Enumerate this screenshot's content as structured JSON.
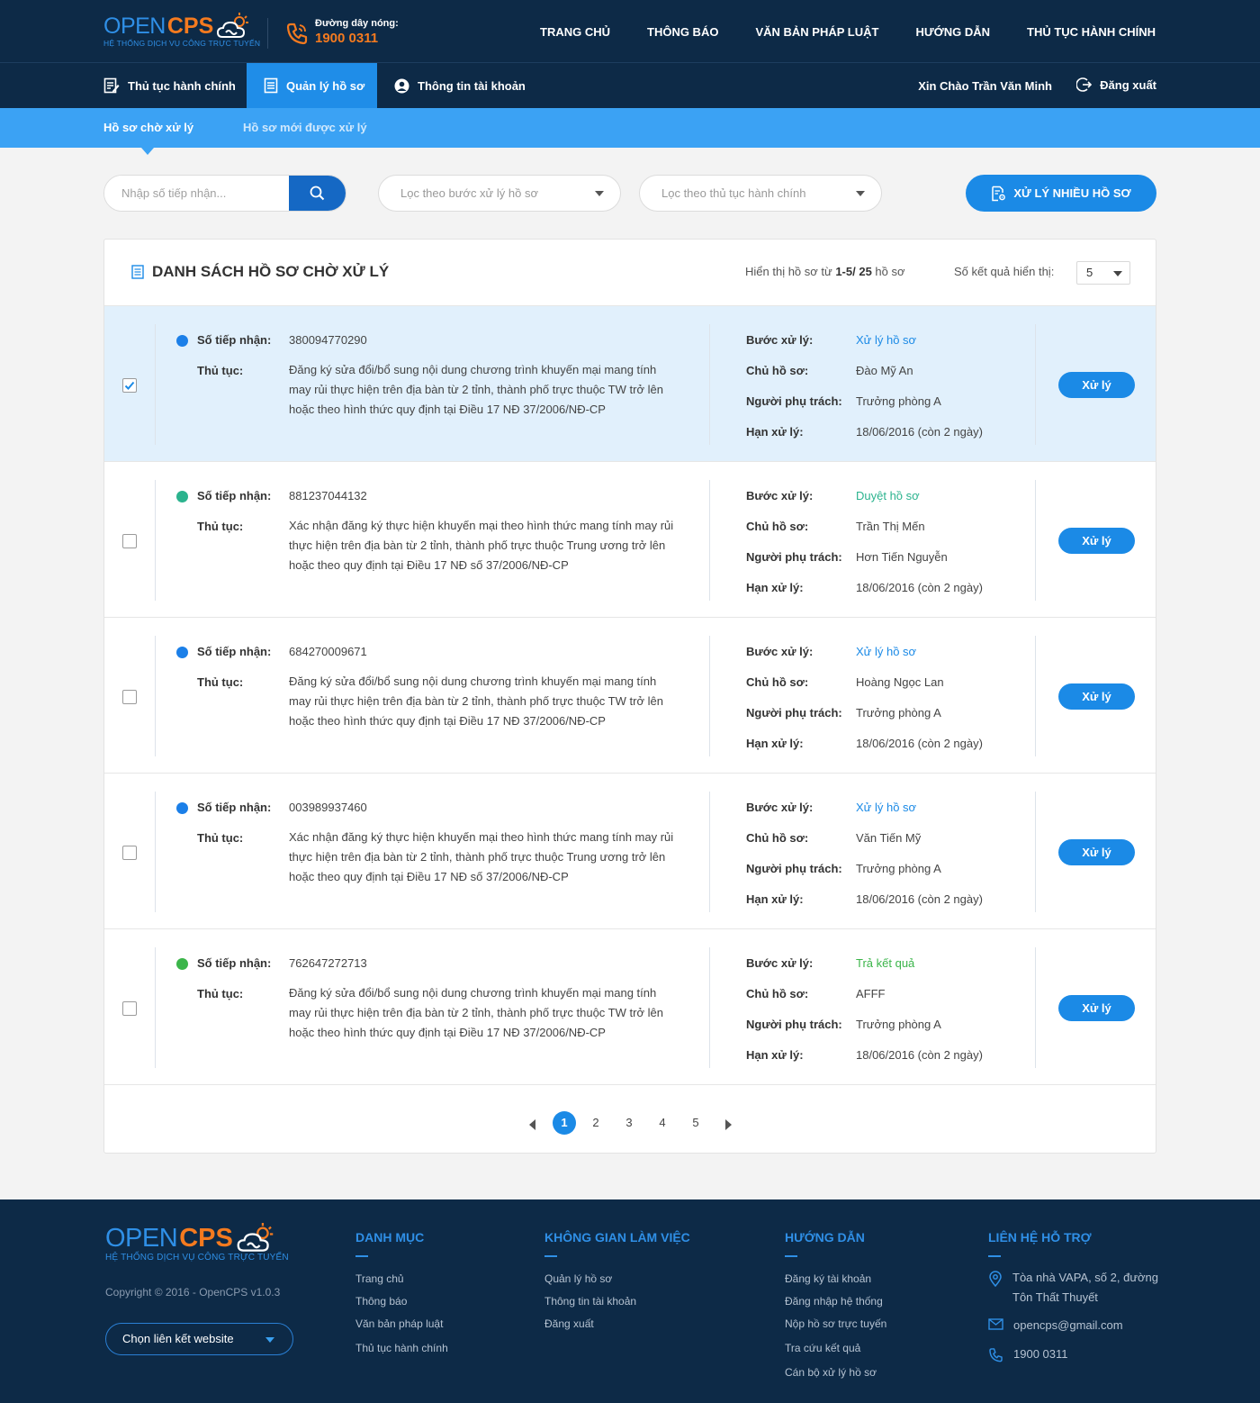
{
  "brand": {
    "open": "OPEN",
    "cps": "CPS",
    "subtitle": "HỆ THỐNG DỊCH VỤ CÔNG TRỰC TUYẾN"
  },
  "hotline": {
    "label": "Đường dây nóng:",
    "number": "1900 0311"
  },
  "main_nav": [
    "TRANG CHỦ",
    "THÔNG BÁO",
    "VĂN BẢN PHÁP LUẬT",
    "HƯỚNG DẪN",
    "THỦ TỤC HÀNH CHÍNH"
  ],
  "sub_nav": {
    "items": [
      "Thủ tục hành chính",
      "Quản lý hồ sơ",
      "Thông tin tài khoản"
    ],
    "active": "Quản lý hồ sơ",
    "greeting": "Xin Chào Trần Văn Minh",
    "logout": "Đăng xuất"
  },
  "tabs": [
    "Hồ sơ chờ xử lý",
    "Hồ sơ mới được xử lý"
  ],
  "filters": {
    "search_placeholder": "Nhập số tiếp nhận...",
    "step_filter": "Lọc theo bước xử lý hồ sơ",
    "procedure_filter": "Lọc theo thủ tục hành chính",
    "bulk_button": "XỬ LÝ NHIỀU HỒ SƠ"
  },
  "panel": {
    "title": "DANH SÁCH HỒ SƠ CHỜ XỬ LÝ",
    "showing_prefix": "Hiển thị hồ sơ từ ",
    "showing_range": "1-5/ 25",
    "showing_suffix": " hồ sơ",
    "per_page_label": "Số kết quả hiển thị:",
    "per_page": "5"
  },
  "labels": {
    "receipt_no": "Số tiếp nhận:",
    "procedure": "Thủ tục:",
    "step": "Bước xử lý:",
    "owner": "Chủ hồ sơ:",
    "assignee": "Người phụ trách:",
    "deadline": "Hạn xử lý:",
    "action": "Xử lý"
  },
  "records": [
    {
      "receipt_no": "380094770290",
      "procedure": "Đăng ký sửa đổi/bổ sung nội dung chương trình khuyến mại mang tính may rủi thực hiện trên địa bàn từ 2 tỉnh, thành phố trực thuộc TW trở lên hoặc theo hình thức quy định tại Điều 17 NĐ 37/2006/NĐ-CP",
      "step": "Xử lý hồ sơ",
      "step_color": "#1b8ae6",
      "dot_color": "#1b7fe8",
      "owner": "Đào Mỹ An",
      "assignee": "Trưởng phòng A",
      "deadline": "18/06/2016 (còn 2 ngày)",
      "checked": true
    },
    {
      "receipt_no": "881237044132",
      "procedure": "Xác nhận đăng ký thực hiện khuyến mại theo hình thức mang tính may rủi thực hiện trên địa bàn từ 2 tỉnh, thành phố trực thuộc Trung ương trở lên hoặc theo quy định tại Điều 17 NĐ số 37/2006/NĐ-CP",
      "step": "Duyệt hồ sơ",
      "step_color": "#2bb38e",
      "dot_color": "#2bb38e",
      "owner": "Trần Thị Mến",
      "assignee": "Hơn Tiến Nguyễn",
      "deadline": "18/06/2016 (còn 2 ngày)",
      "checked": false
    },
    {
      "receipt_no": "684270009671",
      "procedure": "Đăng ký sửa đổi/bổ sung nội dung chương trình khuyến mại mang tính may rủi thực hiện trên địa bàn từ 2 tỉnh, thành phố trực thuộc TW trở lên hoặc theo hình thức quy định tại Điều 17 NĐ 37/2006/NĐ-CP",
      "step": "Xử lý hồ sơ",
      "step_color": "#1b8ae6",
      "dot_color": "#1b7fe8",
      "owner": "Hoàng Ngọc Lan",
      "assignee": "Trưởng phòng A",
      "deadline": "18/06/2016 (còn 2 ngày)",
      "checked": false
    },
    {
      "receipt_no": "003989937460",
      "procedure": "Xác nhận đăng ký thực hiện khuyến mại theo hình thức mang tính may rủi thực hiện trên địa bàn từ 2 tỉnh, thành phố trực thuộc Trung ương trở lên hoặc theo quy định tại Điều 17 NĐ số 37/2006/NĐ-CP",
      "step": "Xử lý hồ sơ",
      "step_color": "#1b8ae6",
      "dot_color": "#1b7fe8",
      "owner": "Văn Tiến Mỹ",
      "assignee": "Trưởng phòng A",
      "deadline": "18/06/2016 (còn 2 ngày)",
      "checked": false
    },
    {
      "receipt_no": "762647272713",
      "procedure": "Đăng ký sửa đổi/bổ sung nội dung chương trình khuyến mại mang tính may rủi thực hiện trên địa bàn từ 2 tỉnh, thành phố trực thuộc TW trở lên hoặc theo hình thức quy định tại Điều 17 NĐ 37/2006/NĐ-CP",
      "step": "Trả kết quả",
      "step_color": "#3bb54a",
      "dot_color": "#3bb54a",
      "owner": "AFFF",
      "assignee": "Trưởng phòng A",
      "deadline": "18/06/2016 (còn 2 ngày)",
      "checked": false
    }
  ],
  "pagination": {
    "pages": [
      "1",
      "2",
      "3",
      "4",
      "5"
    ],
    "current": "1"
  },
  "footer": {
    "copyright": "Copyright © 2016 - OpenCPS v1.0.3",
    "link_select": "Chọn liên kết website",
    "columns": [
      {
        "title": "DANH MỤC",
        "links": [
          "Trang chủ",
          "Thông báo",
          "Văn bản pháp luật",
          "Thủ tục hành chính"
        ]
      },
      {
        "title": "KHÔNG GIAN LÀM VIỆC",
        "links": [
          "Quản lý hồ sơ",
          "Thông tin tài khoản",
          "Đăng xuất"
        ]
      },
      {
        "title": "HƯỚNG DẪN",
        "links": [
          "Đăng ký tài khoản",
          "Đăng nhập hệ thống",
          "Nộp hồ sơ trực tuyến",
          "Tra cứu kết quả",
          "Cán bộ xử lý hồ sơ"
        ]
      }
    ],
    "contact": {
      "title": "LIÊN HỆ HỖ TRỢ",
      "address": "Tòa nhà VAPA, số 2, đường Tôn Thất Thuyết",
      "email": "opencps@gmail.com",
      "phone": "1900 0311"
    }
  },
  "colors": {
    "dark_navy": "#0d2a47",
    "primary_blue": "#1b8ae6",
    "light_blue": "#3ba2f4",
    "orange": "#f47a1f",
    "selected_row": "#e1f0fc"
  }
}
